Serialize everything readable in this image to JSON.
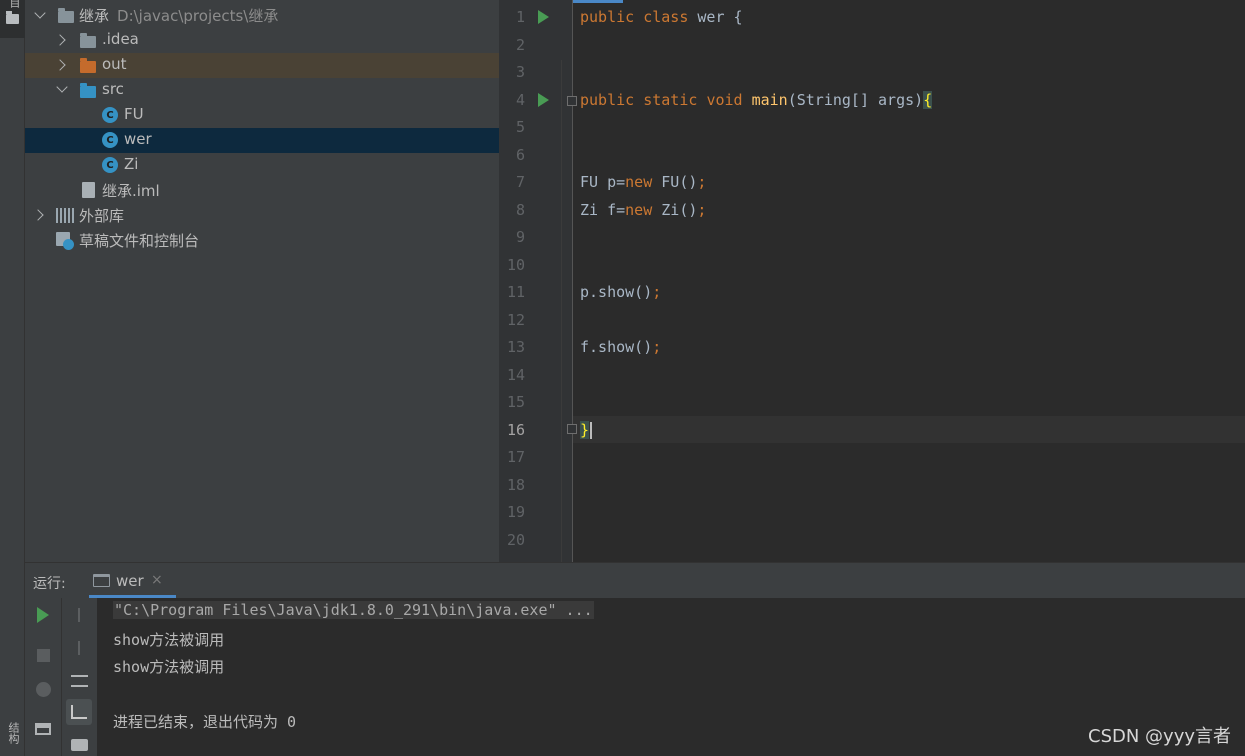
{
  "left_strip": {
    "top_label": "项目",
    "bottom_label": "结构"
  },
  "project_tree": {
    "items": [
      {
        "label": "继承",
        "path": "D:\\javac\\projects\\继承"
      },
      {
        "label": ".idea"
      },
      {
        "label": "out"
      },
      {
        "label": "src"
      },
      {
        "label": "FU"
      },
      {
        "label": "wer"
      },
      {
        "label": "Zi"
      },
      {
        "label": "继承.iml"
      },
      {
        "label": "外部库"
      },
      {
        "label": "草稿文件和控制台"
      }
    ],
    "class_icon_letter": "C",
    "colors": {
      "selected": "#0d293e",
      "highlight_out": "#4a4235",
      "folder_blue": "#3592c4",
      "folder_orange": "#c46b2c",
      "folder_gray": "#87939a"
    }
  },
  "editor": {
    "line_numbers": [
      "1",
      "2",
      "3",
      "4",
      "5",
      "6",
      "7",
      "8",
      "9",
      "10",
      "11",
      "12",
      "13",
      "14",
      "15",
      "16",
      "17",
      "18",
      "19",
      "20"
    ],
    "current_line": "16",
    "code": {
      "l1_kw1": "public",
      "l1_kw2": "class",
      "l1_rest": " wer {",
      "l4_kw1": "public",
      "l4_kw2": "static",
      "l4_kw3": "void",
      "l4_fn": "main",
      "l4_rest": "(String[] args)",
      "l4_brace": "{",
      "l7_a": "FU p=",
      "l7_kw": "new",
      "l7_b": " FU()",
      "l7_semi": ";",
      "l8_a": "Zi f=",
      "l8_kw": "new",
      "l8_b": " Zi()",
      "l8_semi": ";",
      "l11_a": "p.show()",
      "l11_semi": ";",
      "l13_a": "f.show()",
      "l13_semi": ";",
      "l16_brace": "}"
    }
  },
  "run_panel": {
    "title": "运行:",
    "tab_label": "wer",
    "tab_close": "×",
    "console": {
      "command": "\"C:\\Program Files\\Java\\jdk1.8.0_291\\bin\\java.exe\" ...",
      "out1": "show方法被调用",
      "out2": "show方法被调用",
      "exit": "进程已结束，退出代码为 0"
    }
  },
  "watermark": "CSDN @yyy言者"
}
